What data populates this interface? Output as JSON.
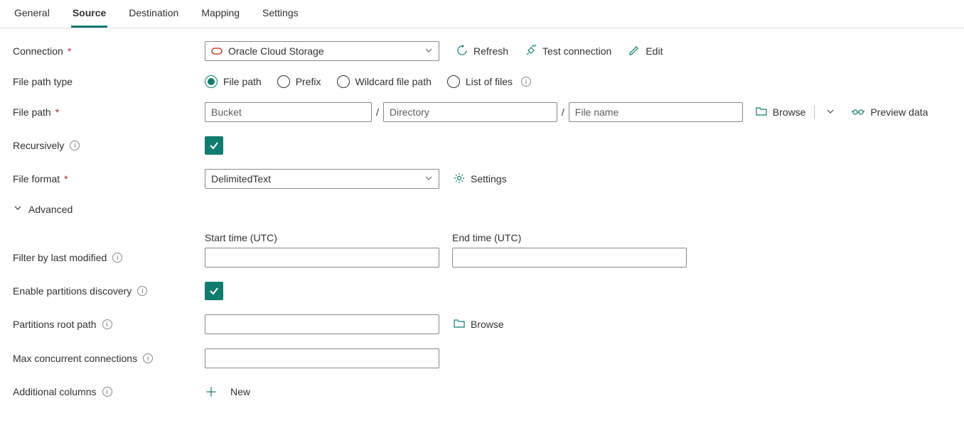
{
  "tabs": {
    "general": "General",
    "source": "Source",
    "destination": "Destination",
    "mapping": "Mapping",
    "settings": "Settings"
  },
  "labels": {
    "connection": "Connection",
    "file_path_type": "File path type",
    "file_path": "File path",
    "recursively": "Recursively",
    "file_format": "File format",
    "advanced": "Advanced",
    "filter_by_last_modified": "Filter by last modified",
    "start_time": "Start time (UTC)",
    "end_time": "End time (UTC)",
    "enable_partitions": "Enable partitions discovery",
    "partitions_root_path": "Partitions root path",
    "max_concurrent": "Max concurrent connections",
    "additional_columns": "Additional columns"
  },
  "connection": {
    "value": "Oracle Cloud Storage"
  },
  "actions": {
    "refresh": "Refresh",
    "test_connection": "Test connection",
    "edit": "Edit",
    "settings": "Settings",
    "browse": "Browse",
    "preview_data": "Preview data",
    "new": "New"
  },
  "file_path_type_options": {
    "file_path": "File path",
    "prefix": "Prefix",
    "wildcard": "Wildcard file path",
    "list_of_files": "List of files"
  },
  "file_path_inputs": {
    "bucket_placeholder": "Bucket",
    "directory_placeholder": "Directory",
    "filename_placeholder": "File name"
  },
  "file_format": {
    "value": "DelimitedText"
  }
}
